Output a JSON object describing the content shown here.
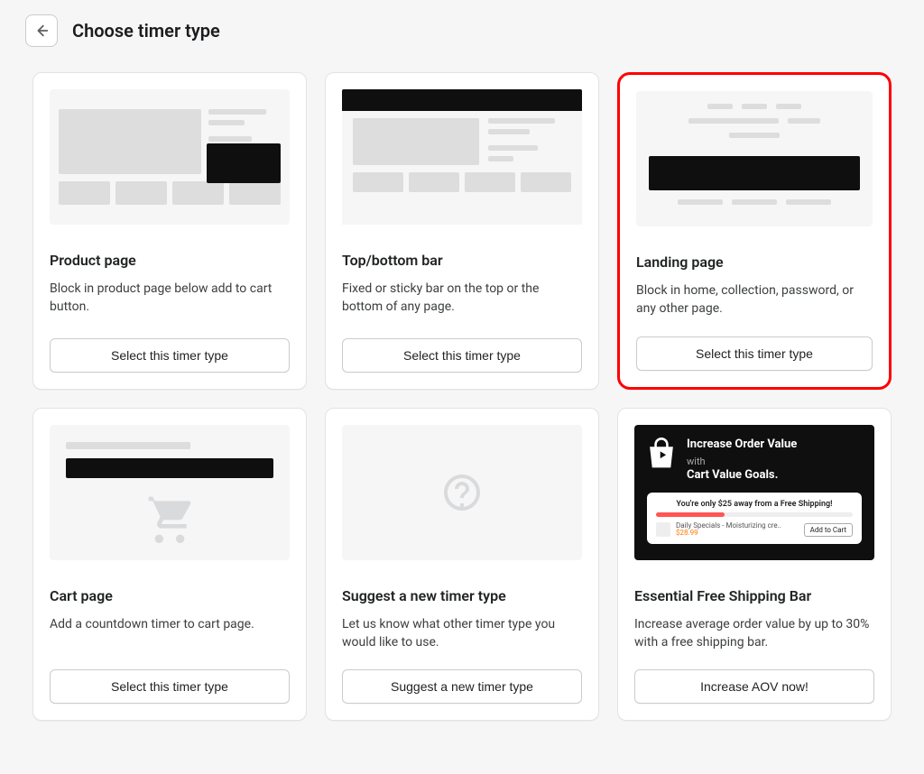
{
  "header": {
    "title": "Choose timer type"
  },
  "cards": {
    "product": {
      "title": "Product page",
      "description": "Block in product page below add to cart button.",
      "button": "Select this timer type"
    },
    "topbar": {
      "title": "Top/bottom bar",
      "description": "Fixed or sticky bar on the top or the bottom of any page.",
      "button": "Select this timer type"
    },
    "landing": {
      "title": "Landing page",
      "description": "Block in home, collection, password, or any other page.",
      "button": "Select this timer type"
    },
    "cart": {
      "title": "Cart page",
      "description": "Add a countdown timer to cart page.",
      "button": "Select this timer type"
    },
    "suggest": {
      "title": "Suggest a new timer type",
      "description": "Let us know what other timer type you would like to use.",
      "button": "Suggest a new timer type"
    },
    "promo": {
      "title": "Essential Free Shipping Bar",
      "description": "Increase average order value by up to 30% with a free shipping bar.",
      "button": "Increase AOV now!",
      "thumb": {
        "line1": "Increase Order Value",
        "withLabel": "with",
        "line2": "Cart Value Goals.",
        "panelMsg": "You're only $25 away from a Free Shipping!",
        "itemName": "Daily Specials - Moisturizing cre..",
        "itemPrice": "$28.99",
        "addBtn": "Add to Cart"
      }
    }
  }
}
